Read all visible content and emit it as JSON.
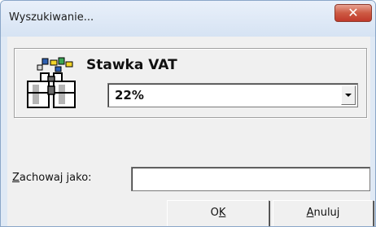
{
  "window": {
    "title": "Wyszukiwanie...",
    "close_symbol": "✕"
  },
  "search": {
    "icon": "binoculars-icon",
    "field_label": "Stawka VAT",
    "selected_value": "22%"
  },
  "save_as": {
    "label_mnemonic": "Z",
    "label_rest": "achowaj jako:",
    "value": ""
  },
  "buttons": {
    "ok_prefix": "O",
    "ok_mnemonic": "K",
    "cancel_mnemonic": "A",
    "cancel_rest": "nuluj"
  }
}
